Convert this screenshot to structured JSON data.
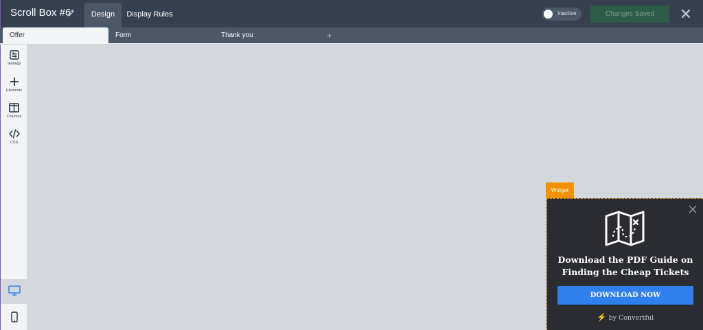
{
  "header": {
    "title": "Scroll Box #6",
    "tabs": [
      {
        "label": "Design",
        "active": true
      },
      {
        "label": "Display Rules",
        "active": false
      }
    ],
    "status_toggle": {
      "label": "Inactive",
      "on": false
    },
    "save_label": "Changes Saved"
  },
  "steps": {
    "tabs": [
      {
        "label": "Offer",
        "active": true
      },
      {
        "label": "Form",
        "active": false
      },
      {
        "label": "Thank you",
        "active": false
      }
    ],
    "add_symbol": "+"
  },
  "sidebar": {
    "items": [
      {
        "label": "Settings",
        "icon": "settings-icon"
      },
      {
        "label": "Elements",
        "icon": "plus-icon"
      },
      {
        "label": "Columns",
        "icon": "columns-icon"
      },
      {
        "label": "CSS",
        "icon": "code-icon"
      }
    ],
    "devices": [
      {
        "icon": "desktop-icon",
        "active": true
      },
      {
        "icon": "mobile-icon",
        "active": false
      }
    ]
  },
  "widget": {
    "tag": "Widget",
    "heading_line1": "Download the PDF Guide on",
    "heading_line2": "Finding the Cheap Tickets",
    "button_label": "DOWNLOAD NOW",
    "powered_by": "by Convertful",
    "icon": "map-icon"
  },
  "colors": {
    "topbar": "#364150",
    "subbar": "#4b5868",
    "canvas": "#d4d7db",
    "widget_tag": "#f39200",
    "widget_bg": "#2a2c31",
    "button": "#2f80ed",
    "accent": "#7a55c9"
  }
}
